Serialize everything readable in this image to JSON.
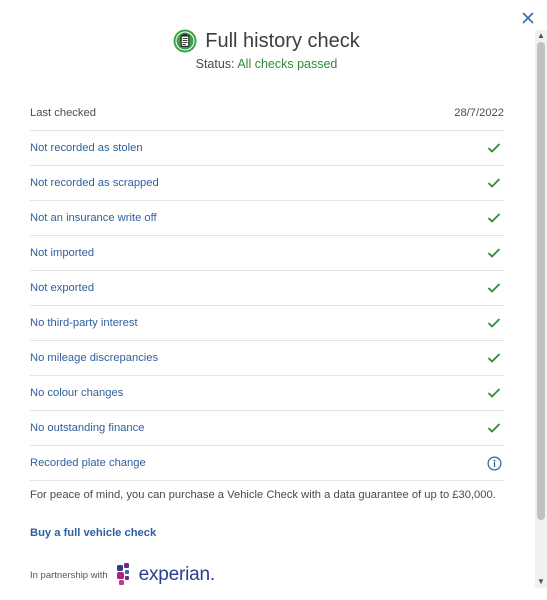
{
  "header": {
    "title": "Full history check",
    "status_label": "Status:",
    "status_value": "All checks passed"
  },
  "last_checked": {
    "label": "Last checked",
    "date": "28/7/2022"
  },
  "checks": [
    {
      "label": "Not recorded as stolen",
      "icon": "check-icon"
    },
    {
      "label": "Not recorded as scrapped",
      "icon": "check-icon"
    },
    {
      "label": "Not an insurance write off",
      "icon": "check-icon"
    },
    {
      "label": "Not imported",
      "icon": "check-icon"
    },
    {
      "label": "Not exported",
      "icon": "check-icon"
    },
    {
      "label": "No third-party interest",
      "icon": "check-icon"
    },
    {
      "label": "No mileage discrepancies",
      "icon": "check-icon"
    },
    {
      "label": "No colour changes",
      "icon": "check-icon"
    },
    {
      "label": "No outstanding finance",
      "icon": "check-icon"
    },
    {
      "label": "Recorded plate change",
      "icon": "info-icon"
    }
  ],
  "note": "For peace of mind, you can purchase a Vehicle Check with a data guarantee of up to £30,000.",
  "buy_link": "Buy a full vehicle check",
  "partner": {
    "label": "In partnership with",
    "logo_text": "experian."
  },
  "colors": {
    "accent_green": "#2e8b3a",
    "link_blue": "#2f5f9e",
    "brand_navy": "#2a3f8f",
    "brand_magenta": "#b0227c"
  }
}
